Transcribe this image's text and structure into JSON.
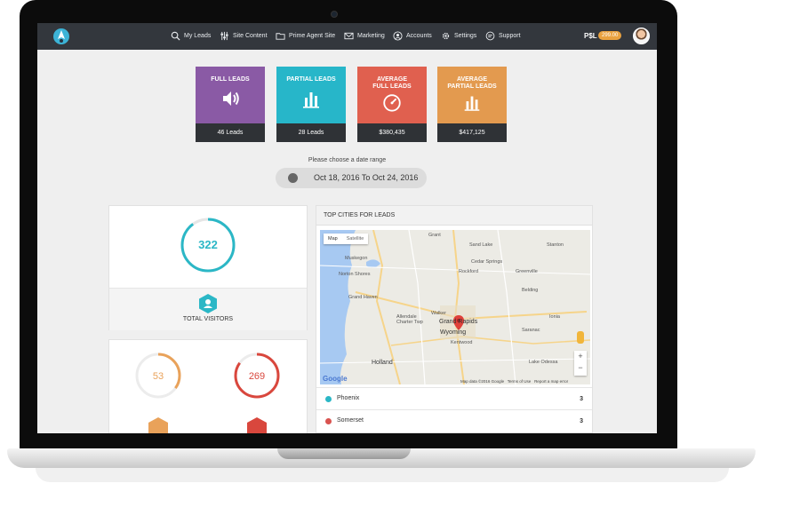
{
  "nav": {
    "items": [
      {
        "label": "My Leads",
        "icon": "search-icon"
      },
      {
        "label": "Site Content",
        "icon": "sliders-icon"
      },
      {
        "label": "Prime Agent Site",
        "icon": "folder-icon"
      },
      {
        "label": "Marketing",
        "icon": "envelope-icon"
      },
      {
        "label": "Accounts",
        "icon": "user-icon"
      },
      {
        "label": "Settings",
        "icon": "gear-icon"
      },
      {
        "label": "Support",
        "icon": "chat-icon"
      }
    ],
    "currency": "P$L",
    "balance": "299.00"
  },
  "stats": [
    {
      "title": "FULL LEADS",
      "value": "46 Leads",
      "color": "#8a5aa5",
      "icon": "speaker-icon"
    },
    {
      "title": "PARTIAL LEADS",
      "value": "28 Leads",
      "color": "#27b6c9",
      "icon": "bar-chart-icon"
    },
    {
      "title": "AVERAGE FULL LEADS",
      "value": "$380,435",
      "color": "#e0604f",
      "icon": "gauge-icon"
    },
    {
      "title": "AVERAGE PARTIAL LEADS",
      "value": "$417,125",
      "color": "#e39a4f",
      "icon": "bar-chart-icon"
    }
  ],
  "date_range": {
    "label": "Please choose a date range",
    "value": "Oct 18, 2016 To Oct 24, 2016"
  },
  "visitors": {
    "count": "322",
    "label": "TOTAL VISITORS",
    "ring_fraction": 0.9
  },
  "small_stats": [
    {
      "value": "53",
      "color": "#e9a25a",
      "ring_fraction": 0.35
    },
    {
      "value": "269",
      "color": "#d9473d",
      "ring_fraction": 0.85
    }
  ],
  "top_cities": {
    "title": "TOP CITIES FOR LEADS",
    "map_tabs": [
      "Map",
      "Satellite"
    ],
    "map_cities": [
      "Grant",
      "Sand Lake",
      "Stanton",
      "Muskegon",
      "Cedar Springs",
      "Norton Shores",
      "Rockford",
      "Greenville",
      "Grand Haven",
      "Belding",
      "Allendale Charter Twp",
      "Walker",
      "Grand Rapids",
      "Ionia",
      "Wyoming",
      "Saranac",
      "Kentwood",
      "Holland",
      "Lake Odessa"
    ],
    "brand": "Google",
    "attribution": [
      "Map data ©2016 Google",
      "Terms of Use",
      "Report a map error"
    ],
    "zoom": [
      "+",
      "−"
    ],
    "rows": [
      {
        "name": "Phoenix",
        "count": "3",
        "color": "#2bb7c6"
      },
      {
        "name": "Somerset",
        "count": "3",
        "color": "#d9534f"
      }
    ]
  }
}
